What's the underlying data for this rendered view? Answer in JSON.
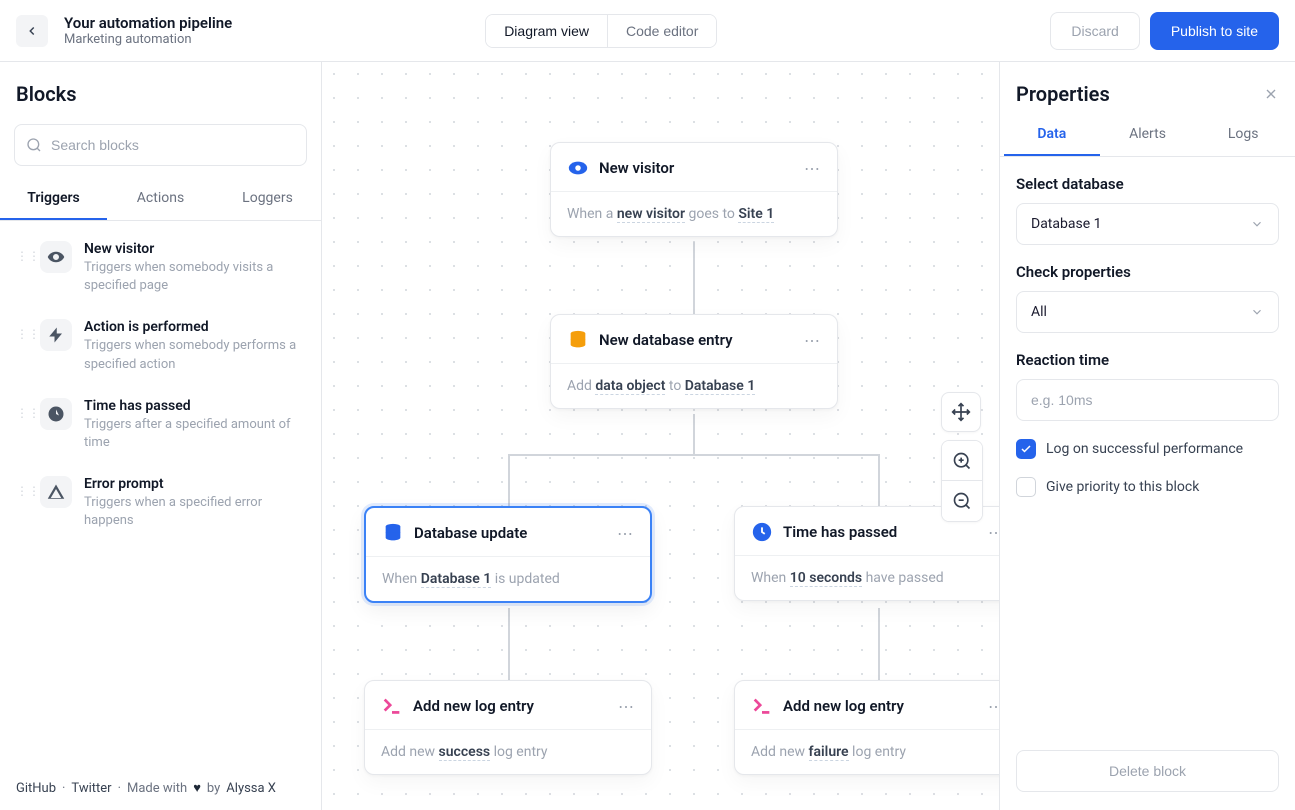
{
  "header": {
    "title": "Your automation pipeline",
    "subtitle": "Marketing automation",
    "view_tabs": {
      "diagram": "Diagram view",
      "code": "Code editor"
    },
    "discard": "Discard",
    "publish": "Publish to site"
  },
  "sidebar": {
    "title": "Blocks",
    "search_placeholder": "Search blocks",
    "tabs": {
      "triggers": "Triggers",
      "actions": "Actions",
      "loggers": "Loggers"
    },
    "blocks": [
      {
        "title": "New visitor",
        "desc": "Triggers when somebody visits a specified page",
        "icon": "eye"
      },
      {
        "title": "Action is performed",
        "desc": "Triggers when somebody performs a specified action",
        "icon": "bolt"
      },
      {
        "title": "Time has passed",
        "desc": "Triggers after a specified amount of time",
        "icon": "clock"
      },
      {
        "title": "Error prompt",
        "desc": "Triggers when a specified error happens",
        "icon": "warning"
      }
    ]
  },
  "footer": {
    "github": "GitHub",
    "twitter": "Twitter",
    "made": "Made with",
    "by": "by",
    "author": "Alyssa X"
  },
  "nodes": {
    "n1": {
      "title": "New visitor",
      "body_prefix": "When a ",
      "body_b1": "new visitor",
      "body_mid": " goes to ",
      "body_b2": "Site 1"
    },
    "n2": {
      "title": "New database entry",
      "body_prefix": "Add ",
      "body_b1": "data object",
      "body_mid": " to ",
      "body_b2": "Database 1"
    },
    "n3": {
      "title": "Database update",
      "body_prefix": "When ",
      "body_b1": "Database 1",
      "body_suffix": " is updated"
    },
    "n4": {
      "title": "Time has passed",
      "body_prefix": "When ",
      "body_b1": "10 seconds",
      "body_suffix": " have passed"
    },
    "n5": {
      "title": "Add new log entry",
      "body_prefix": "Add new ",
      "body_b1": "success",
      "body_suffix": " log entry"
    },
    "n6": {
      "title": "Add new log entry",
      "body_prefix": "Add new ",
      "body_b1": "failure",
      "body_suffix": " log entry"
    }
  },
  "properties": {
    "title": "Properties",
    "tabs": {
      "data": "Data",
      "alerts": "Alerts",
      "logs": "Logs"
    },
    "select_database_label": "Select database",
    "select_database_value": "Database 1",
    "check_properties_label": "Check properties",
    "check_properties_value": "All",
    "reaction_time_label": "Reaction time",
    "reaction_time_placeholder": "e.g. 10ms",
    "log_success_label": "Log on successful performance",
    "priority_label": "Give priority to this block",
    "delete_label": "Delete block"
  }
}
